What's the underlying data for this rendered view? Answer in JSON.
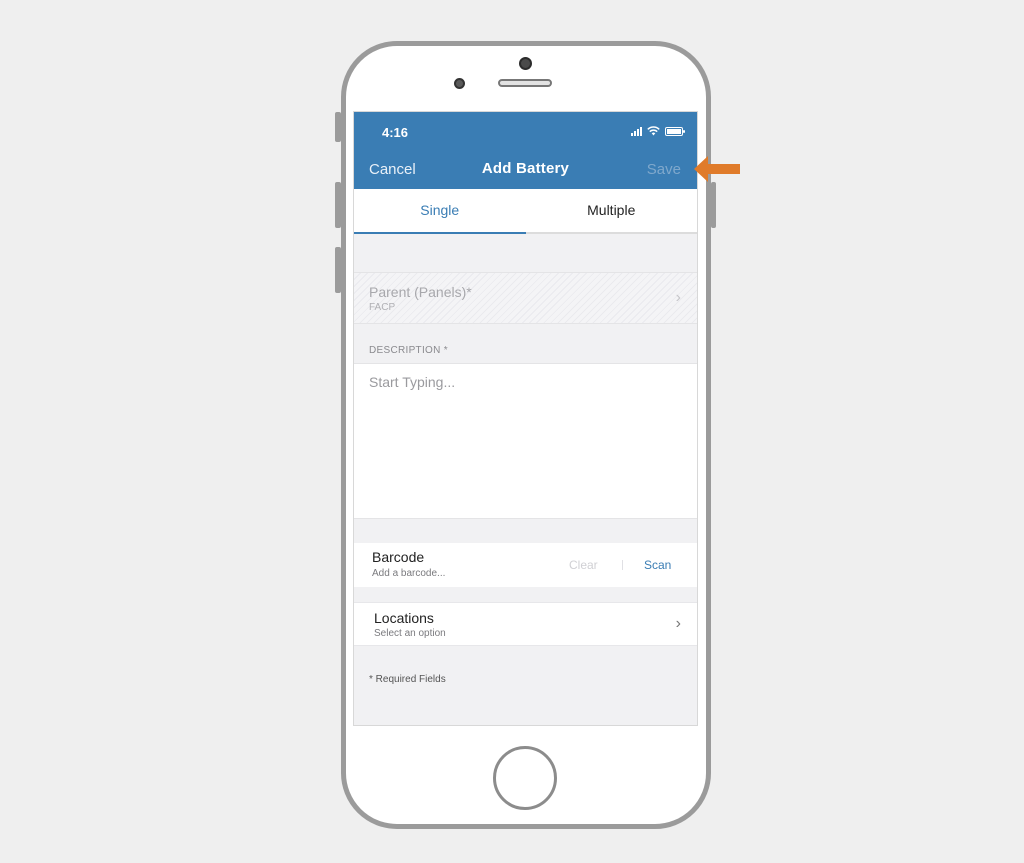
{
  "status_bar": {
    "time": "4:16"
  },
  "nav": {
    "cancel_label": "Cancel",
    "title": "Add Battery",
    "save_label": "Save"
  },
  "tabs": [
    {
      "label": "Single",
      "active": true
    },
    {
      "label": "Multiple",
      "active": false
    }
  ],
  "parent_field": {
    "label": "Parent (Panels)*",
    "value": "FACP"
  },
  "description": {
    "label": "DESCRIPTION *",
    "placeholder": "Start Typing..."
  },
  "barcode": {
    "label": "Barcode",
    "placeholder": "Add a barcode...",
    "clear_label": "Clear",
    "scan_label": "Scan"
  },
  "locations": {
    "label": "Locations",
    "placeholder": "Select an option"
  },
  "footer": {
    "required_note": "* Required Fields"
  },
  "colors": {
    "header": "#3a7db4",
    "annotation_arrow": "#e07b2a"
  }
}
